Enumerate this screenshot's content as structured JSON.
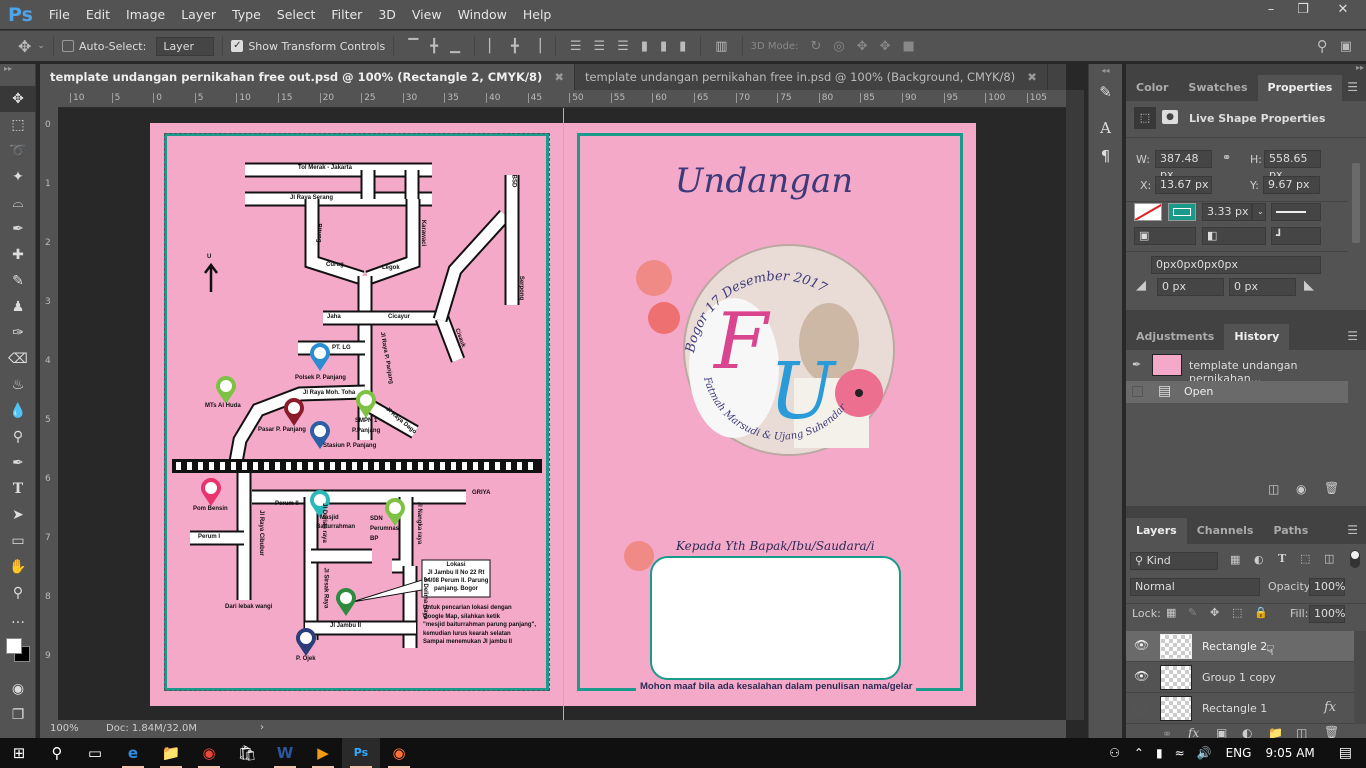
{
  "app": {
    "logo": "Ps",
    "menu": [
      "File",
      "Edit",
      "Image",
      "Layer",
      "Type",
      "Select",
      "Filter",
      "3D",
      "View",
      "Window",
      "Help"
    ],
    "window_controls": [
      "minimize",
      "restore",
      "close"
    ]
  },
  "options": {
    "auto_select_label": "Auto-Select:",
    "auto_select_checked": false,
    "layer_select": "Layer",
    "show_transform_label": "Show Transform Controls",
    "show_transform_checked": true,
    "mode_3d_label": "3D Mode:"
  },
  "tabs": [
    {
      "label": "template undangan pernikahan free out.psd @ 100% (Rectangle 2, CMYK/8)",
      "active": true
    },
    {
      "label": "template undangan pernikahan free in.psd @ 100% (Background, CMYK/8)",
      "active": false
    }
  ],
  "ruler": {
    "top": [
      "10",
      "5",
      "0",
      "5",
      "10",
      "15",
      "20",
      "25",
      "30",
      "35",
      "40",
      "45",
      "50",
      "55",
      "60",
      "65",
      "70",
      "75",
      "80",
      "85",
      "90",
      "95",
      "100",
      "105"
    ],
    "left": [
      "0",
      "1",
      "2",
      "3",
      "4",
      "5",
      "6",
      "7",
      "8",
      "9"
    ]
  },
  "status": {
    "zoom": "100%",
    "doc": "Doc: 1.84M/32.0M"
  },
  "document": {
    "map": {
      "labels": {
        "tol": "Tol Merak - Jakarta",
        "serang": "Jl Raya Serang",
        "bitung": "Bitung",
        "karawaci": "Karawaci",
        "bsd": "BSD",
        "curug": "Curug",
        "legok": "Legok",
        "serpong": "Serpong",
        "north": "U",
        "jaha": "Jaha",
        "cicayur": "Cicayur",
        "cisauk": "Cisauk",
        "ptlg": "PT. LG",
        "panjang": "Jl Raya P. Panjang",
        "polsek": "Polsek P. Panjang",
        "mts": "MTs Al Huda",
        "toha": "Jl Raya Moh. Toha",
        "pasar": "Pasar P. Panjang",
        "smpn": "SMPN 1",
        "smpn2": "P.Panjang",
        "dago": "Jl Raya Dago",
        "stasiun": "Stasiun P. Panjang",
        "griya": "GRIYA",
        "pom": "Pom Bensin",
        "perum2": "Perum II",
        "masjid1": "Masjid",
        "masjid2": "Baiturrahman",
        "sdn1": "SDN",
        "sdn2": "Perumnas",
        "sdn3": "BP",
        "perum1": "Perum I",
        "cibubur": "Jl Raya Cibubur",
        "durian": "Jl Durian raya",
        "nangka": "Jl Nangka raya",
        "sirsak": "Jl Sirsak Raya",
        "delima": "Jl Delima Raya",
        "lebak": "Dari lebak wangi",
        "jambu": "Jl Jambu II",
        "ojek": "P. Ojek",
        "lokasi": [
          "Lokasi",
          "Jl Jambu II No 22 Rt",
          "04/08 Perum II. Parung",
          "panjang. Bogor"
        ],
        "note": [
          "Untuk pencarian lokasi dengan",
          "Google Map, silahkan ketik",
          "\"mesjid baiturrahman parung panjang\",",
          "kemudian lurus kearah selatan",
          "Sampai menemukan Jl jambu II"
        ]
      },
      "pins": [
        {
          "name": "police",
          "color": "#2a8dd4"
        },
        {
          "name": "school",
          "color": "#7dc242"
        },
        {
          "name": "market",
          "color": "#8b1a2b"
        },
        {
          "name": "school",
          "color": "#7dc242"
        },
        {
          "name": "train",
          "color": "#2b5fa8"
        },
        {
          "name": "fuel",
          "color": "#e8336d"
        },
        {
          "name": "mosque",
          "color": "#2ab8b8"
        },
        {
          "name": "school",
          "color": "#7dc242"
        },
        {
          "name": "home",
          "color": "#2e8b3e"
        },
        {
          "name": "motorbike",
          "color": "#2a3d7a"
        }
      ]
    },
    "invite": {
      "title": "Undangan",
      "date": "Bogor 17 Desember 2017",
      "initial1": "F",
      "initial2": "U",
      "names": "Fatmah Marsudi & Ujang Suhendar",
      "to": "Kepada Yth Bapak/Ibu/Saudara/i",
      "apology": "Mohon maaf bila ada kesalahan dalam penulisan nama/gelar"
    },
    "colors": {
      "page": "#f5a9c9",
      "frame": "#1a9a8a",
      "title": "#3d3a7a",
      "f": "#d9458f",
      "u": "#2a9bd8"
    }
  },
  "properties": {
    "tabs": [
      "Color",
      "Swatches",
      "Properties"
    ],
    "active_tab": "Properties",
    "header": "Live Shape Properties",
    "w_label": "W:",
    "w": "387.48 px",
    "h_label": "H:",
    "h": "558.65 px",
    "x_label": "X:",
    "x": "13.67 px",
    "y_label": "Y:",
    "y": "9.67 px",
    "stroke_width": "3.33 px",
    "corners": "0px0px0px0px",
    "corner_a": "0 px",
    "corner_b": "0 px",
    "stroke_color": "#1a9a8a"
  },
  "history": {
    "tabs": [
      "Adjustments",
      "History"
    ],
    "active_tab": "History",
    "items": [
      "template undangan pernikahan...",
      "Open"
    ]
  },
  "layers": {
    "tabs": [
      "Layers",
      "Channels",
      "Paths"
    ],
    "active_tab": "Layers",
    "filter": "Kind",
    "blend": "Normal",
    "opacity_label": "Opacity:",
    "opacity": "100%",
    "lock_label": "Lock:",
    "fill_label": "Fill:",
    "fill": "100%",
    "items": [
      {
        "name": "Rectangle 2",
        "visible": true,
        "selected": true
      },
      {
        "name": "Group 1 copy",
        "visible": true,
        "selected": false
      },
      {
        "name": "Rectangle 1",
        "visible": false,
        "selected": false,
        "fx": "fx"
      }
    ]
  },
  "taskbar": {
    "apps": [
      "start",
      "search",
      "task-view",
      "edge",
      "file-explorer",
      "chrome",
      "store",
      "word",
      "media-player",
      "photoshop",
      "firefox"
    ],
    "lang": "ENG",
    "time": "9:05 AM"
  }
}
